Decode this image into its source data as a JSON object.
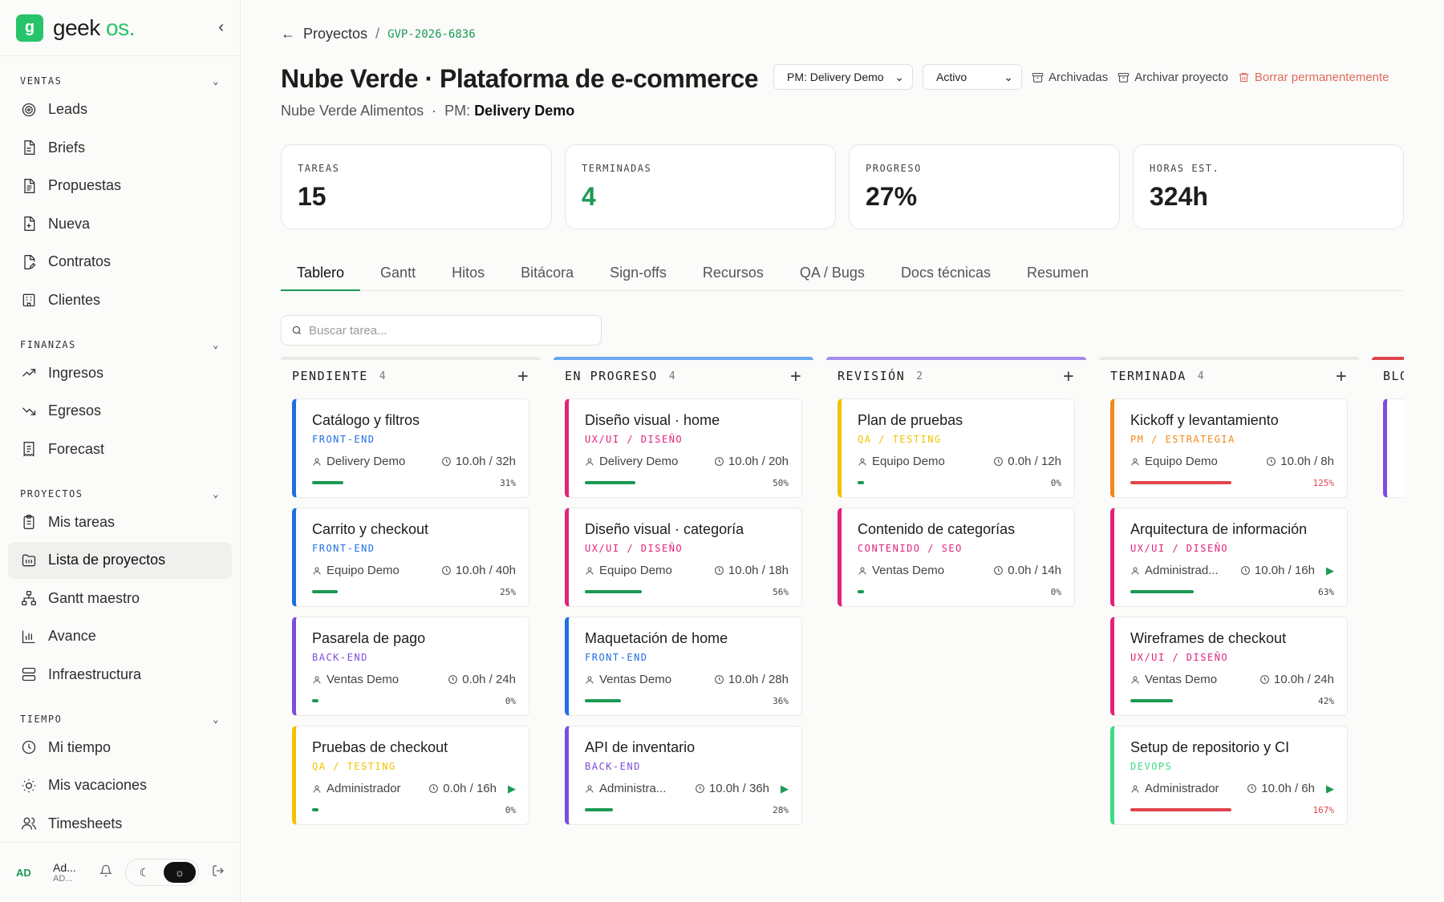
{
  "brand": {
    "mark": "g",
    "name": "geek",
    "suffix": "os."
  },
  "sidebar": {
    "sections": [
      {
        "title": "VENTAS",
        "items": [
          {
            "label": "Leads",
            "icon": "target-icon"
          },
          {
            "label": "Briefs",
            "icon": "file-icon"
          },
          {
            "label": "Propuestas",
            "icon": "file-text-icon"
          },
          {
            "label": "Nueva",
            "icon": "file-plus-icon"
          },
          {
            "label": "Contratos",
            "icon": "file-signature-icon"
          },
          {
            "label": "Clientes",
            "icon": "building-icon"
          }
        ]
      },
      {
        "title": "FINANZAS",
        "items": [
          {
            "label": "Ingresos",
            "icon": "trending-up-icon"
          },
          {
            "label": "Egresos",
            "icon": "trending-down-icon"
          },
          {
            "label": "Forecast",
            "icon": "receipt-icon"
          }
        ]
      },
      {
        "title": "PROYECTOS",
        "items": [
          {
            "label": "Mis tareas",
            "icon": "clipboard-icon"
          },
          {
            "label": "Lista de proyectos",
            "icon": "folder-icon"
          },
          {
            "label": "Gantt maestro",
            "icon": "network-icon"
          },
          {
            "label": "Avance",
            "icon": "bar-chart-icon"
          },
          {
            "label": "Infraestructura",
            "icon": "server-icon"
          }
        ]
      },
      {
        "title": "TIEMPO",
        "items": [
          {
            "label": "Mi tiempo",
            "icon": "clock-icon"
          },
          {
            "label": "Mis vacaciones",
            "icon": "sun-icon"
          },
          {
            "label": "Timesheets",
            "icon": "users-icon"
          }
        ]
      }
    ],
    "active": "Lista de proyectos",
    "user": {
      "initials": "AD",
      "name": "Ad...",
      "sub": "AD..."
    }
  },
  "breadcrumb": {
    "back": "Proyectos",
    "separator": "/",
    "code": "GVP-2026-6836"
  },
  "project": {
    "title": "Nube Verde · Plataforma de e-commerce",
    "client": "Nube Verde Alimentos",
    "dot": "·",
    "pm_label": "PM:",
    "pm_name": "Delivery Demo"
  },
  "actions": {
    "pm_select": "PM: Delivery Demo",
    "status_select": "Activo",
    "archived": "Archivadas",
    "archive": "Archivar proyecto",
    "delete": "Borrar permanentemente"
  },
  "stats": [
    {
      "label": "TAREAS",
      "value": "15"
    },
    {
      "label": "TERMINADAS",
      "value": "4"
    },
    {
      "label": "PROGRESO",
      "value": "27%"
    },
    {
      "label": "HORAS EST.",
      "value": "324h"
    }
  ],
  "tabs": [
    "Tablero",
    "Gantt",
    "Hitos",
    "Bitácora",
    "Sign-offs",
    "Recursos",
    "QA / Bugs",
    "Docs técnicas",
    "Resumen"
  ],
  "active_tab": "Tablero",
  "search": {
    "placeholder": "Buscar tarea..."
  },
  "colors": {
    "accent": "#1a9a54",
    "front_end": "#1f6fe0",
    "ux_ui": "#e0237a",
    "back_end": "#7c4ddb",
    "qa": "#f2c200",
    "pm": "#f08a1c",
    "contenido": "#e0237a",
    "devops": "#3ddc84",
    "progress_ok": "#1a9a54",
    "progress_over": "#e0444c"
  },
  "columns": [
    {
      "title": "PENDIENTE",
      "count": "4",
      "top_color": "#e8e8e6",
      "cards": [
        {
          "title": "Catálogo y filtros",
          "category": "FRONT-END",
          "cat_color": "#1f6fe0",
          "border": "#1f6fe0",
          "assignee": "Delivery Demo",
          "hours": "10.0h / 32h",
          "progress": 31,
          "pct": "31%",
          "playing": false
        },
        {
          "title": "Carrito y checkout",
          "category": "FRONT-END",
          "cat_color": "#1f6fe0",
          "border": "#1f6fe0",
          "assignee": "Equipo Demo",
          "hours": "10.0h / 40h",
          "progress": 25,
          "pct": "25%",
          "playing": false
        },
        {
          "title": "Pasarela de pago",
          "category": "BACK-END",
          "cat_color": "#7c4ddb",
          "border": "#7c4ddb",
          "assignee": "Ventas Demo",
          "hours": "0.0h / 24h",
          "progress": 0,
          "pct": "0%",
          "playing": false
        },
        {
          "title": "Pruebas de checkout",
          "category": "QA / TESTING",
          "cat_color": "#f2c200",
          "border": "#f2c200",
          "assignee": "Administrador",
          "hours": "0.0h / 16h",
          "progress": 0,
          "pct": "0%",
          "playing": true
        }
      ]
    },
    {
      "title": "EN PROGRESO",
      "count": "4",
      "top_color": "#6aa8f0",
      "cards": [
        {
          "title": "Diseño visual · home",
          "category": "UX/UI / DISEÑO",
          "cat_color": "#e0237a",
          "border": "#e0237a",
          "assignee": "Delivery Demo",
          "hours": "10.0h / 20h",
          "progress": 50,
          "pct": "50%",
          "playing": false
        },
        {
          "title": "Diseño visual · categoría",
          "category": "UX/UI / DISEÑO",
          "cat_color": "#e0237a",
          "border": "#e0237a",
          "assignee": "Equipo Demo",
          "hours": "10.0h / 18h",
          "progress": 56,
          "pct": "56%",
          "playing": false
        },
        {
          "title": "Maquetación de home",
          "category": "FRONT-END",
          "cat_color": "#1f6fe0",
          "border": "#1f6fe0",
          "assignee": "Ventas Demo",
          "hours": "10.0h / 28h",
          "progress": 36,
          "pct": "36%",
          "playing": false
        },
        {
          "title": "API de inventario",
          "category": "BACK-END",
          "cat_color": "#7c4ddb",
          "border": "#7c4ddb",
          "assignee": "Administra...",
          "hours": "10.0h / 36h",
          "progress": 28,
          "pct": "28%",
          "playing": true
        }
      ]
    },
    {
      "title": "REVISIÓN",
      "count": "2",
      "top_color": "#a48cf0",
      "cards": [
        {
          "title": "Plan de pruebas",
          "category": "QA / TESTING",
          "cat_color": "#f2c200",
          "border": "#f2c200",
          "assignee": "Equipo Demo",
          "hours": "0.0h / 12h",
          "progress": 0,
          "pct": "0%",
          "playing": false
        },
        {
          "title": "Contenido de categorías",
          "category": "CONTENIDO / SEO",
          "cat_color": "#e0237a",
          "border": "#e0237a",
          "assignee": "Ventas Demo",
          "hours": "0.0h / 14h",
          "progress": 0,
          "pct": "0%",
          "playing": false
        }
      ]
    },
    {
      "title": "TERMINADA",
      "count": "4",
      "top_color": "#e8e8e6",
      "cards": [
        {
          "title": "Kickoff y levantamiento",
          "category": "PM / ESTRATEGIA",
          "cat_color": "#f08a1c",
          "border": "#f08a1c",
          "assignee": "Equipo Demo",
          "hours": "10.0h / 8h",
          "progress": 125,
          "pct": "125%",
          "playing": false
        },
        {
          "title": "Arquitectura de información",
          "category": "UX/UI / DISEÑO",
          "cat_color": "#e0237a",
          "border": "#e0237a",
          "assignee": "Administrad...",
          "hours": "10.0h / 16h",
          "progress": 63,
          "pct": "63%",
          "playing": true
        },
        {
          "title": "Wireframes de checkout",
          "category": "UX/UI / DISEÑO",
          "cat_color": "#e0237a",
          "border": "#e0237a",
          "assignee": "Ventas Demo",
          "hours": "10.0h / 24h",
          "progress": 42,
          "pct": "42%",
          "playing": false
        },
        {
          "title": "Setup de repositorio y CI",
          "category": "DEVOPS",
          "cat_color": "#3ddc84",
          "border": "#3ddc84",
          "assignee": "Administrador",
          "hours": "10.0h / 6h",
          "progress": 167,
          "pct": "167%",
          "playing": true
        }
      ]
    },
    {
      "title": "BLOQUEADA",
      "count": "",
      "top_color": "#e0444c",
      "cards": []
    }
  ]
}
